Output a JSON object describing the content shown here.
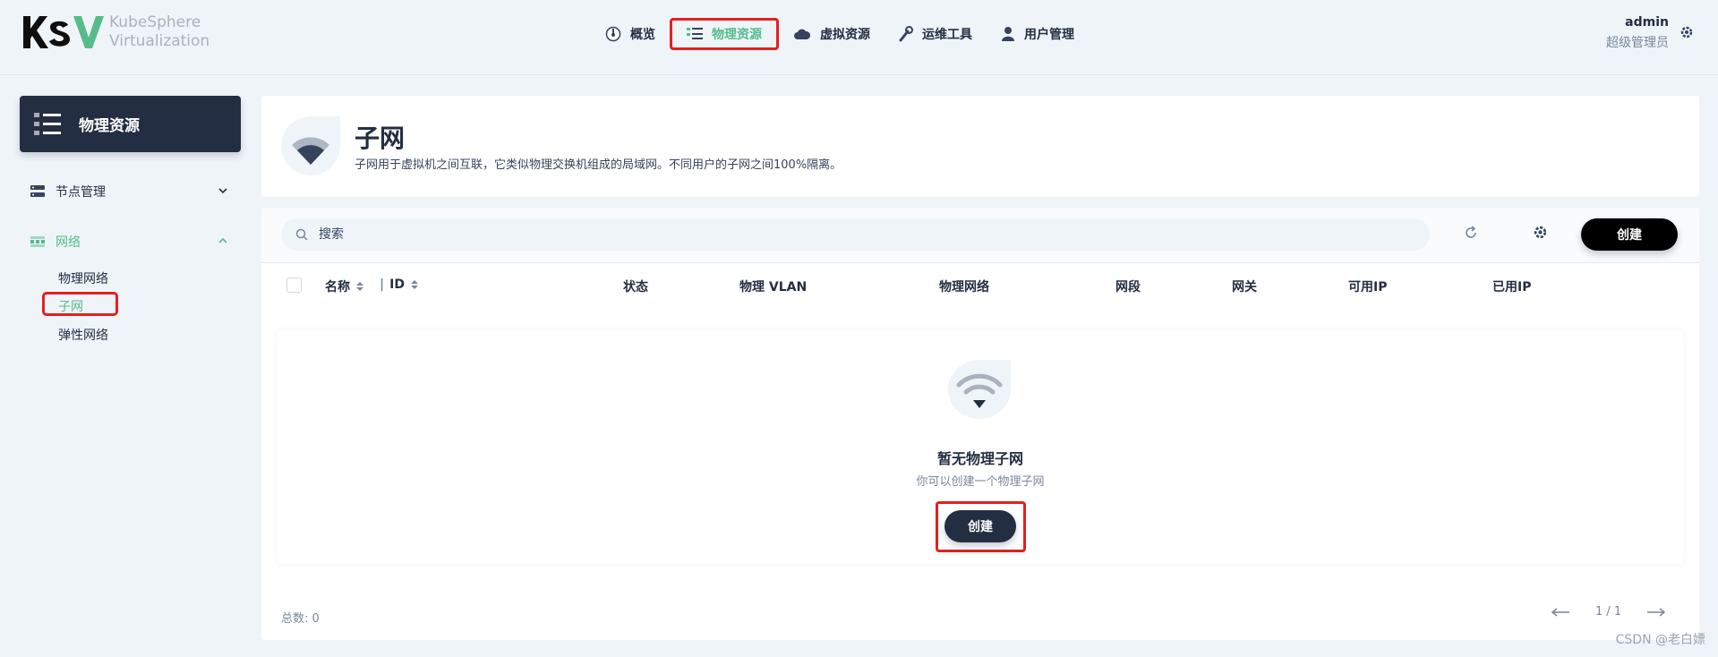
{
  "brand": {
    "name_line1": "KubeSphere",
    "name_line2": "Virtualization",
    "logo_text": "KSV"
  },
  "nav": [
    {
      "label": "概览",
      "icon": "dashboard-icon"
    },
    {
      "label": "物理资源",
      "icon": "list-icon",
      "active": true
    },
    {
      "label": "虚拟资源",
      "icon": "cloud-icon"
    },
    {
      "label": "运维工具",
      "icon": "wrench-icon"
    },
    {
      "label": "用户管理",
      "icon": "user-icon"
    }
  ],
  "user": {
    "name": "admin",
    "role": "超级管理员"
  },
  "sidebar": {
    "title": "物理资源",
    "groups": [
      {
        "label": "节点管理",
        "icon": "server-icon",
        "expanded": false
      },
      {
        "label": "网络",
        "icon": "network-icon",
        "expanded": true,
        "items": [
          {
            "label": "物理网络"
          },
          {
            "label": "子网",
            "active": true
          },
          {
            "label": "弹性网络"
          }
        ]
      }
    ]
  },
  "page": {
    "title": "子网",
    "description": "子网用于虚拟机之间互联，它类似物理交换机组成的局域网。不同用户的子网之间100%隔离。"
  },
  "toolbar": {
    "search_placeholder": "搜索",
    "create_label": "创建"
  },
  "table": {
    "columns": [
      "名称",
      "ID",
      "状态",
      "物理 VLAN",
      "物理网络",
      "网段",
      "网关",
      "可用IP",
      "已用IP"
    ],
    "rows": []
  },
  "empty": {
    "title": "暂无物理子网",
    "description": "你可以创建一个物理子网",
    "create_label": "创建"
  },
  "footer": {
    "total_label": "总数:",
    "total_value": "0",
    "page": "1 / 1"
  },
  "watermark": "CSDN @老白嫖",
  "colors": {
    "accent": "#55bc8a",
    "dark": "#242e42",
    "highlight": "#e51f1f",
    "background": "#eff4f9"
  }
}
